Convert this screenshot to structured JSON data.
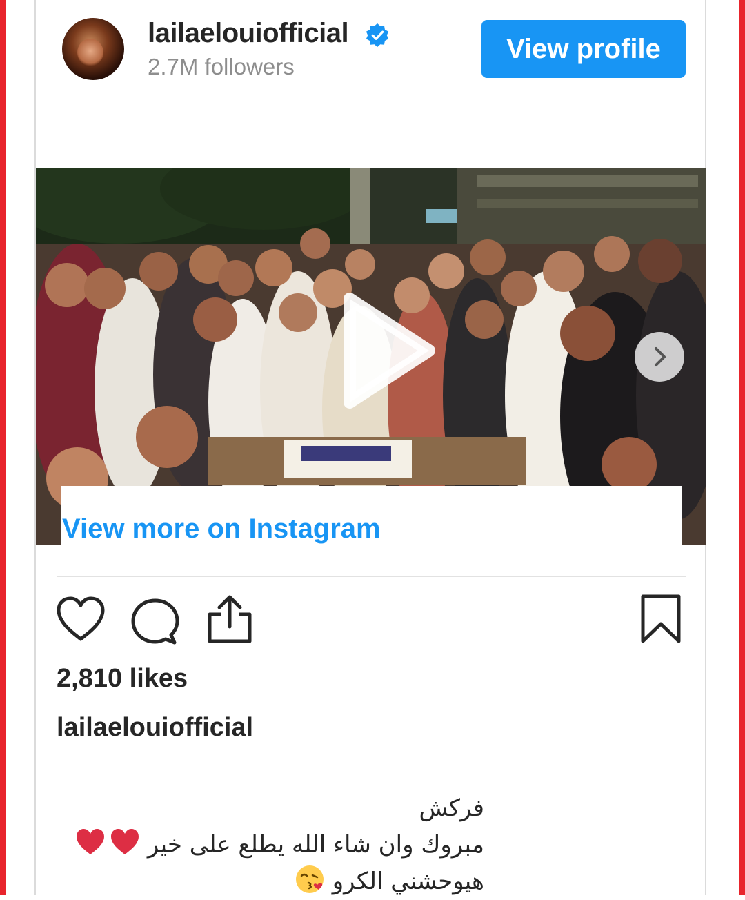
{
  "header": {
    "username": "lailaelouiofficial",
    "verified_icon": "verified-badge-icon",
    "followers": "2.7M followers",
    "view_profile_label": "View profile"
  },
  "media": {
    "play_icon": "play-icon",
    "next_icon": "chevron-right-icon",
    "view_more_label": "View more on Instagram"
  },
  "actions": {
    "like_icon": "heart-icon",
    "comment_icon": "comment-icon",
    "share_icon": "share-icon",
    "save_icon": "bookmark-icon"
  },
  "post": {
    "likes": "2,810 likes",
    "caption_user": "lailaelouiofficial",
    "caption_lines": [
      "فركش",
      "مبروك وان شاء الله يطلع على خير",
      "هيوحشني الكرو"
    ]
  },
  "colors": {
    "accent_blue": "#1895f4",
    "frame_red": "#e8242c",
    "text_dark": "#262626",
    "text_muted": "#8e8e8e",
    "heart_red": "#dd2e44"
  }
}
